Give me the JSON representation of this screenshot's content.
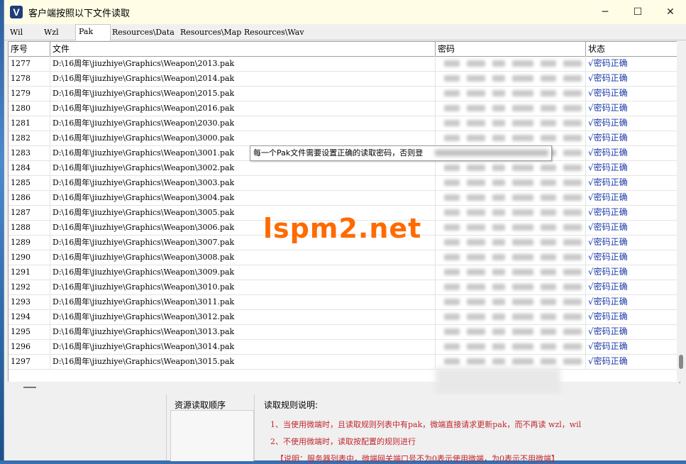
{
  "window": {
    "title": "客户端按照以下文件读取",
    "icon_letter": "V",
    "minimize": "─",
    "maximize": "☐",
    "close": "✕"
  },
  "tabs": [
    "Wil",
    "Wzl",
    "Pak",
    "Resources\\Data",
    "Resources\\Map",
    "Resources\\Wav"
  ],
  "active_tab": "Pak",
  "grid": {
    "headers": [
      "序号",
      "文件",
      "密码",
      "状态"
    ],
    "rows": [
      {
        "no": "1277",
        "file": "D:\\16周年\\jiuzhiye\\Graphics\\Weapon\\2013.pak",
        "status": "√密码正确"
      },
      {
        "no": "1278",
        "file": "D:\\16周年\\jiuzhiye\\Graphics\\Weapon\\2014.pak",
        "status": "√密码正确"
      },
      {
        "no": "1279",
        "file": "D:\\16周年\\jiuzhiye\\Graphics\\Weapon\\2015.pak",
        "status": "√密码正确"
      },
      {
        "no": "1280",
        "file": "D:\\16周年\\jiuzhiye\\Graphics\\Weapon\\2016.pak",
        "status": "√密码正确"
      },
      {
        "no": "1281",
        "file": "D:\\16周年\\jiuzhiye\\Graphics\\Weapon\\2030.pak",
        "status": "√密码正确"
      },
      {
        "no": "1282",
        "file": "D:\\16周年\\jiuzhiye\\Graphics\\Weapon\\3000.pak",
        "status": "√密码正确"
      },
      {
        "no": "1283",
        "file": "D:\\16周年\\jiuzhiye\\Graphics\\Weapon\\3001.pak",
        "status": "√密码正确"
      },
      {
        "no": "1284",
        "file": "D:\\16周年\\jiuzhiye\\Graphics\\Weapon\\3002.pak",
        "status": "√密码正确"
      },
      {
        "no": "1285",
        "file": "D:\\16周年\\jiuzhiye\\Graphics\\Weapon\\3003.pak",
        "status": "√密码正确"
      },
      {
        "no": "1286",
        "file": "D:\\16周年\\jiuzhiye\\Graphics\\Weapon\\3004.pak",
        "status": "√密码正确"
      },
      {
        "no": "1287",
        "file": "D:\\16周年\\jiuzhiye\\Graphics\\Weapon\\3005.pak",
        "status": "√密码正确"
      },
      {
        "no": "1288",
        "file": "D:\\16周年\\jiuzhiye\\Graphics\\Weapon\\3006.pak",
        "status": "√密码正确"
      },
      {
        "no": "1289",
        "file": "D:\\16周年\\jiuzhiye\\Graphics\\Weapon\\3007.pak",
        "status": "√密码正确"
      },
      {
        "no": "1290",
        "file": "D:\\16周年\\jiuzhiye\\Graphics\\Weapon\\3008.pak",
        "status": "√密码正确"
      },
      {
        "no": "1291",
        "file": "D:\\16周年\\jiuzhiye\\Graphics\\Weapon\\3009.pak",
        "status": "√密码正确"
      },
      {
        "no": "1292",
        "file": "D:\\16周年\\jiuzhiye\\Graphics\\Weapon\\3010.pak",
        "status": "√密码正确"
      },
      {
        "no": "1293",
        "file": "D:\\16周年\\jiuzhiye\\Graphics\\Weapon\\3011.pak",
        "status": "√密码正确"
      },
      {
        "no": "1294",
        "file": "D:\\16周年\\jiuzhiye\\Graphics\\Weapon\\3012.pak",
        "status": "√密码正确"
      },
      {
        "no": "1295",
        "file": "D:\\16周年\\jiuzhiye\\Graphics\\Weapon\\3013.pak",
        "status": "√密码正确"
      },
      {
        "no": "1296",
        "file": "D:\\16周年\\jiuzhiye\\Graphics\\Weapon\\3014.pak",
        "status": "√密码正确"
      },
      {
        "no": "1297",
        "file": "D:\\16周年\\jiuzhiye\\Graphics\\Weapon\\3015.pak",
        "status": "√密码正确"
      }
    ]
  },
  "tooltip": "每一个Pak文件需要设置正确的读取密码，否则登",
  "watermark": "lspm2.net",
  "bottom": {
    "order_title": "资源读取顺序",
    "rules_title": "读取规则说明:",
    "rules": [
      "1、当使用微端时，且读取规则列表中有pak，微端直接请求更新pak，而不再读 wzl，wil",
      "2、不使用微端时，读取按配置的规则进行",
      "【说明：服务器列表中，微端网关端口号不为0表示使用微端，为0表示不用微端】"
    ]
  },
  "colors": {
    "status_text": "#1b3aa8",
    "rule_text": "#c0272d",
    "watermark": "#ff6a00",
    "titlebar_bg": "#fffde6"
  }
}
